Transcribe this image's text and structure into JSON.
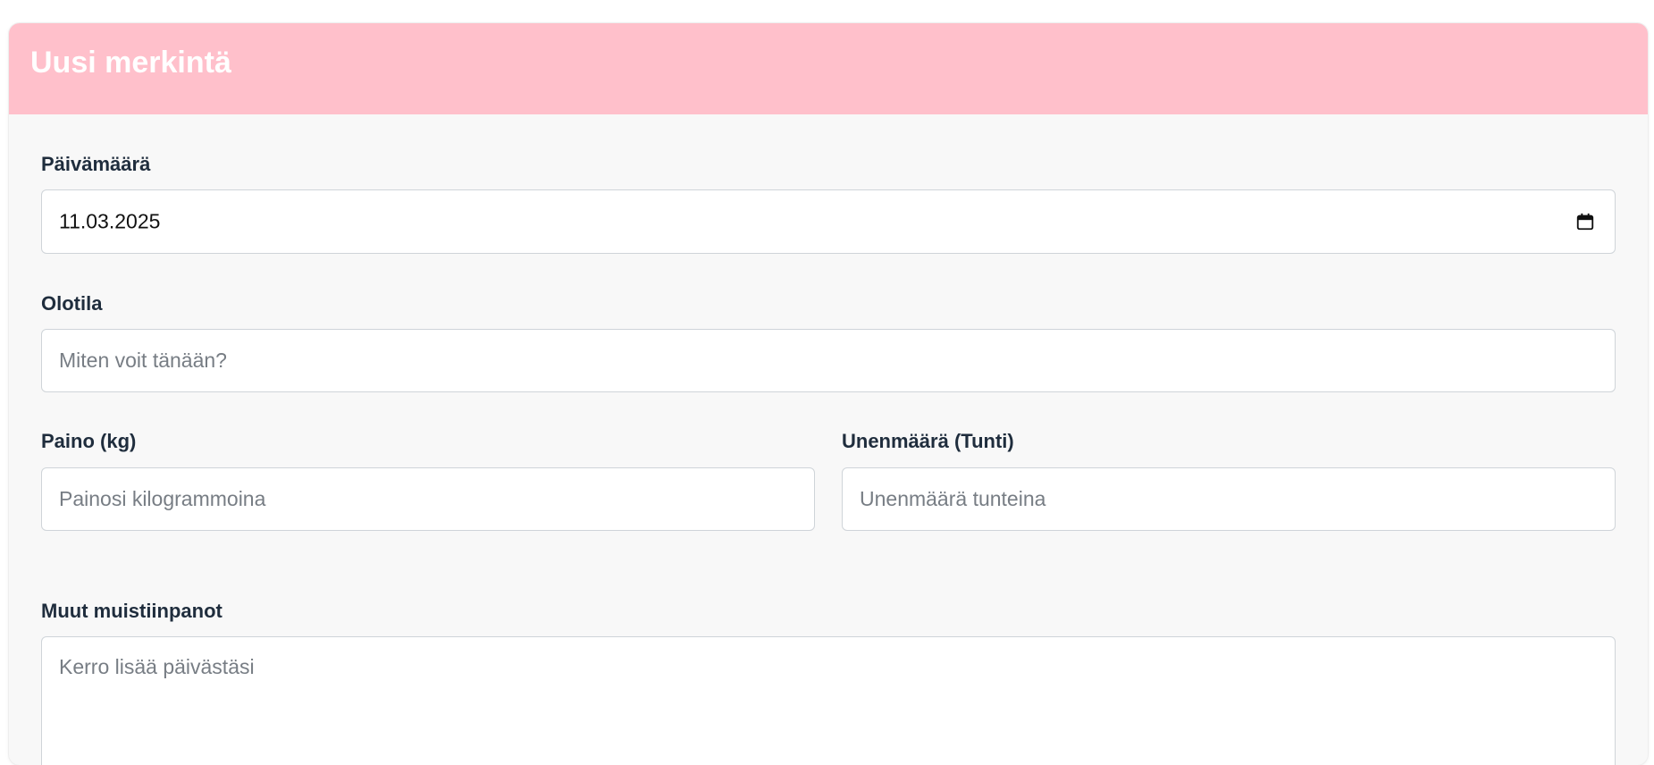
{
  "form": {
    "title": "Uusi merkintä",
    "date": {
      "label": "Päivämäärä",
      "value": "11.03.2025",
      "icon": "calendar-icon"
    },
    "mood": {
      "label": "Olotila",
      "placeholder": "Miten voit tänään?"
    },
    "weight": {
      "label": "Paino (kg)",
      "placeholder": "Painosi kilogrammoina"
    },
    "sleep": {
      "label": "Unenmäärä (Tunti)",
      "placeholder": "Unenmäärä tunteina"
    },
    "notes": {
      "label": "Muut muistiinpanot",
      "placeholder": "Kerro lisää päivästäsi"
    }
  },
  "colors": {
    "header_bg": "#ffc0cb",
    "header_text": "#ffffff",
    "card_bg": "#f8f8f8",
    "label_text": "#1f2d3d",
    "input_border": "#cfd4d9",
    "placeholder_text": "#777d84"
  }
}
